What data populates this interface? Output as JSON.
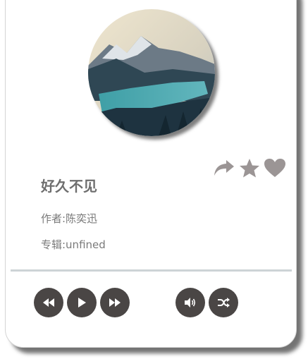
{
  "song": {
    "title": "好久不见",
    "artist_line": "作者:陈奕迅",
    "album_line": "专辑:unfined"
  },
  "cover": {
    "icon": "album-cover-image"
  },
  "actions": {
    "share_icon": "share-icon",
    "favorite_icon": "star-icon",
    "like_icon": "heart-icon",
    "icon_color": "#9b9595"
  },
  "controls": {
    "previous_icon": "rewind-icon",
    "play_icon": "play-icon",
    "next_icon": "fast-forward-icon",
    "volume_icon": "volume-icon",
    "shuffle_icon": "shuffle-icon",
    "button_color": "#4a4645"
  }
}
